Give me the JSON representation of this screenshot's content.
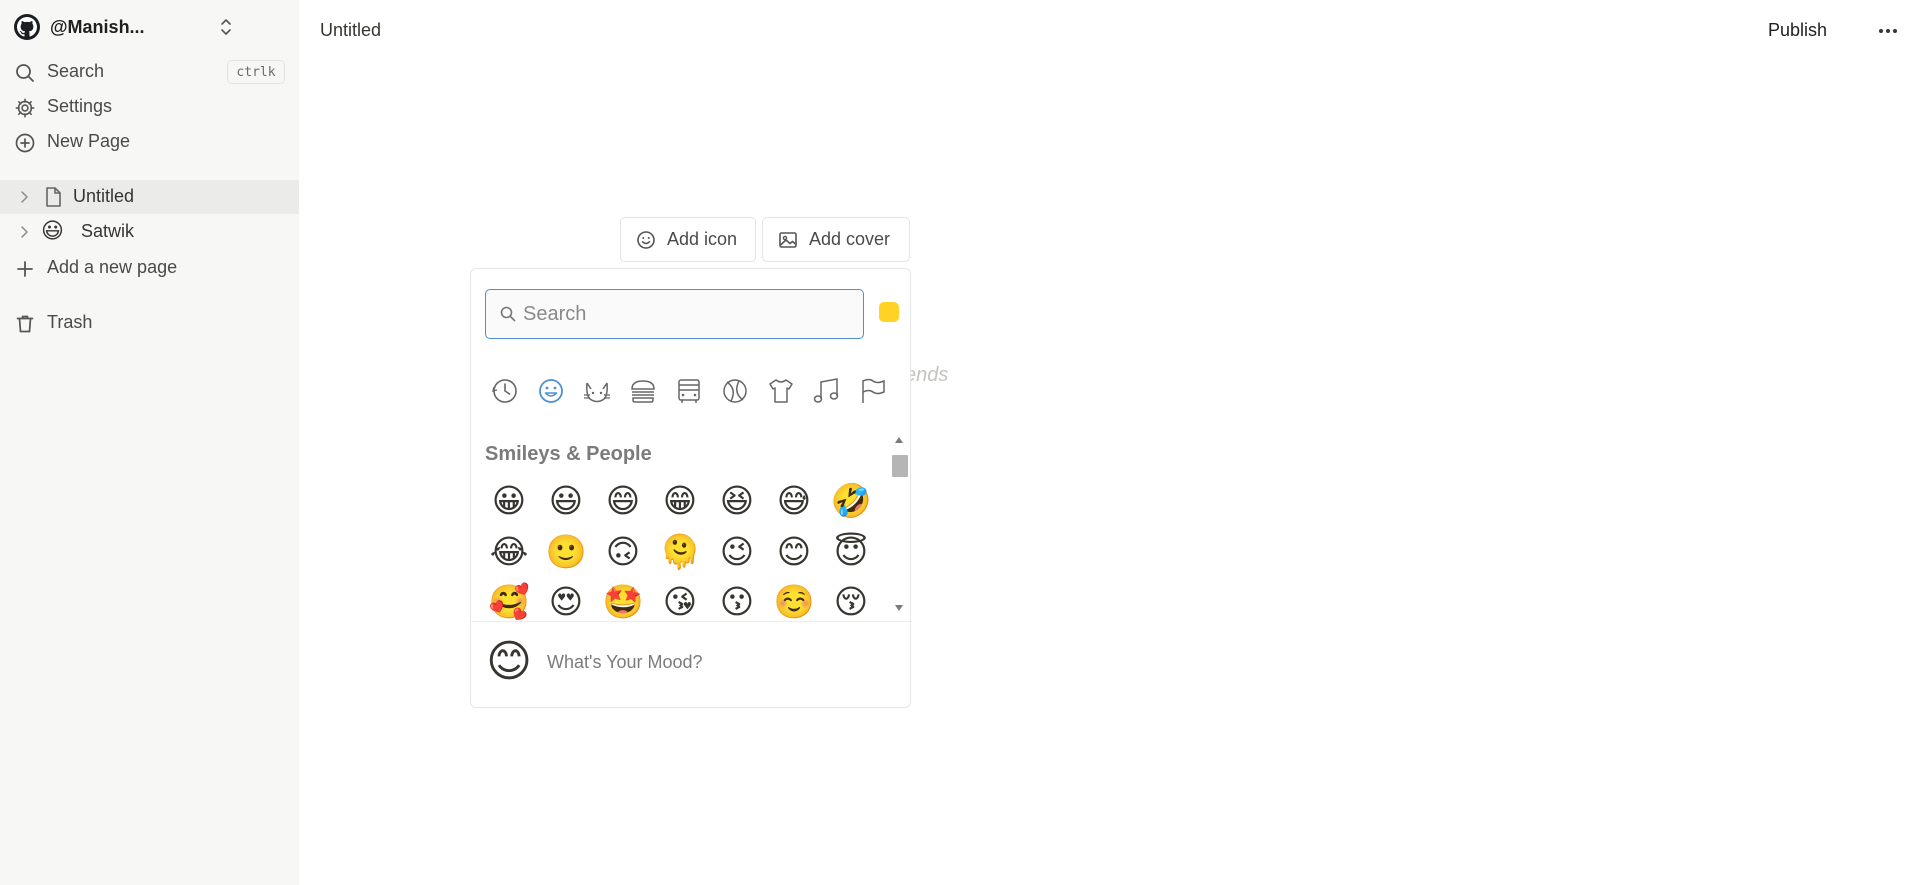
{
  "sidebar": {
    "workspace": {
      "name": "@Manish..."
    },
    "nav": {
      "search_label": "Search",
      "search_shortcut": "ctrlk",
      "settings_label": "Settings",
      "new_page_label": "New Page"
    },
    "pages": [
      {
        "label": "Untitled",
        "icon": "page-icon",
        "active": true
      },
      {
        "label": "Satwik",
        "icon": "😃",
        "active": false
      }
    ],
    "add_page_label": "Add a new page",
    "trash_label": "Trash"
  },
  "topbar": {
    "title": "Untitled",
    "publish_label": "Publish"
  },
  "editor": {
    "add_icon_label": "Add icon",
    "add_cover_label": "Add cover",
    "ghost_text": "ends"
  },
  "emoji_picker": {
    "search_placeholder": "Search",
    "skin_tone_color": "#ffd225",
    "categories": [
      "recent-icon",
      "smileys-icon",
      "animals-icon",
      "food-icon",
      "travel-icon",
      "activity-icon",
      "objects-icon",
      "symbols-icon",
      "flags-icon"
    ],
    "active_category": "smileys-icon",
    "section_title": "Smileys & People",
    "emoji_rows": [
      [
        "😀",
        "😃",
        "😄",
        "😁",
        "😆",
        "😅",
        "🤣"
      ],
      [
        "😂",
        "🙂",
        "🙃",
        "🫠",
        "😉",
        "😊",
        "😇"
      ],
      [
        "🥰",
        "😍",
        "🤩",
        "😘",
        "😗",
        "☺️",
        "😚"
      ]
    ],
    "mood_emoji": "😊",
    "mood_text": "What's Your Mood?"
  },
  "colors": {
    "sidebar_bg": "#f7f7f5",
    "active_row": "#ebebea",
    "accent_blue": "#4e90d0"
  }
}
